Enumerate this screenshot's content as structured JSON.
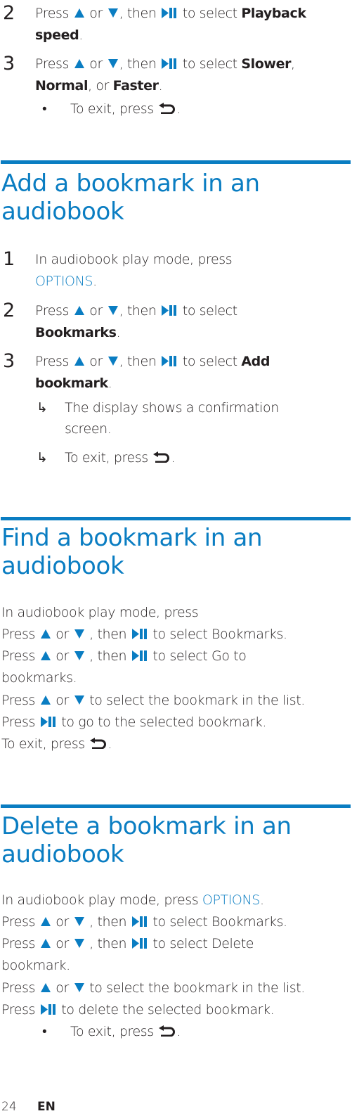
{
  "colors": {
    "accent": "#0a7dc2",
    "text": "#231f20"
  },
  "icons": {
    "up": "up-arrow-icon",
    "down": "down-arrow-icon",
    "play_pause": "play-pause-icon",
    "back": "back-icon",
    "result_arrow": "↳",
    "bullet": "•"
  },
  "section0": {
    "step2": {
      "num": "2",
      "pre": "Press",
      "or": "or",
      "then": ", then",
      "to_select": "to select",
      "bold": "Playback",
      "bold2": "speed",
      "end": "."
    },
    "step3": {
      "num": "3",
      "pre": "Press",
      "or": "or",
      "then": ", then",
      "to_select": "to select",
      "b1": "Slower",
      "comma": ",",
      "b2": "Normal",
      "or2": ", or",
      "b3": "Faster",
      "end": "."
    },
    "bullet": {
      "text": "To exit, press",
      "end": "."
    }
  },
  "section1": {
    "title_line1": "Add a bookmark in an",
    "title_line2": "audiobook",
    "step1": {
      "num": "1",
      "text": "In audiobook play mode, press",
      "options": "OPTIONS",
      "end": "."
    },
    "step2": {
      "num": "2",
      "pre": "Press",
      "or": "or",
      "then": ", then",
      "to_select": "to select",
      "bold": "Bookmarks",
      "end": "."
    },
    "step3": {
      "num": "3",
      "pre": "Press",
      "or": "or",
      "then": ", then",
      "to_select": "to select",
      "bold": "Add",
      "bold2": "bookmark",
      "end": "."
    },
    "result1": {
      "line1": "The display shows a confirmation",
      "line2": "screen."
    },
    "result2": {
      "text": "To exit, press",
      "end": "."
    }
  },
  "section2": {
    "title_line1": "Find a bookmark in an",
    "title_line2": "audiobook",
    "lines": {
      "l1": "In audiobook play mode, press",
      "l2_pre": "Press",
      "l2_or": "or",
      "l2_then": " , then",
      "l2_post": "to select Bookmarks.",
      "l3_pre": "Press",
      "l3_or": "or",
      "l3_then": " , then",
      "l3_post": "to select Go to",
      "l4": "bookmarks.",
      "l5_pre": "Press",
      "l5_or": "or",
      "l5_post": "to select the bookmark in the list.",
      "l6_pre": "Press",
      "l6_post": "to go to the selected bookmark.",
      "l7_pre": "To exit, press",
      "l7_end": "."
    }
  },
  "section3": {
    "title_line1": "Delete a bookmark in an",
    "title_line2": "audiobook",
    "lines": {
      "l1": "In audiobook play mode, press",
      "l1_options": "OPTIONS",
      "l1_end": ".",
      "l2_pre": "Press",
      "l2_or": "or",
      "l2_then": " , then",
      "l2_post": "to select Bookmarks.",
      "l3_pre": "Press",
      "l3_or": "or",
      "l3_then": " , then",
      "l3_post": "to select Delete",
      "l4": "bookmark.",
      "l5_pre": "Press",
      "l5_or": "or",
      "l5_post": "to select the bookmark in the list.",
      "l6_pre": "Press",
      "l6_post": "to delete the selected bookmark.",
      "bullet_text": "To exit, press",
      "bullet_end": "."
    }
  },
  "footer": {
    "page_number": "24",
    "language": "EN"
  }
}
